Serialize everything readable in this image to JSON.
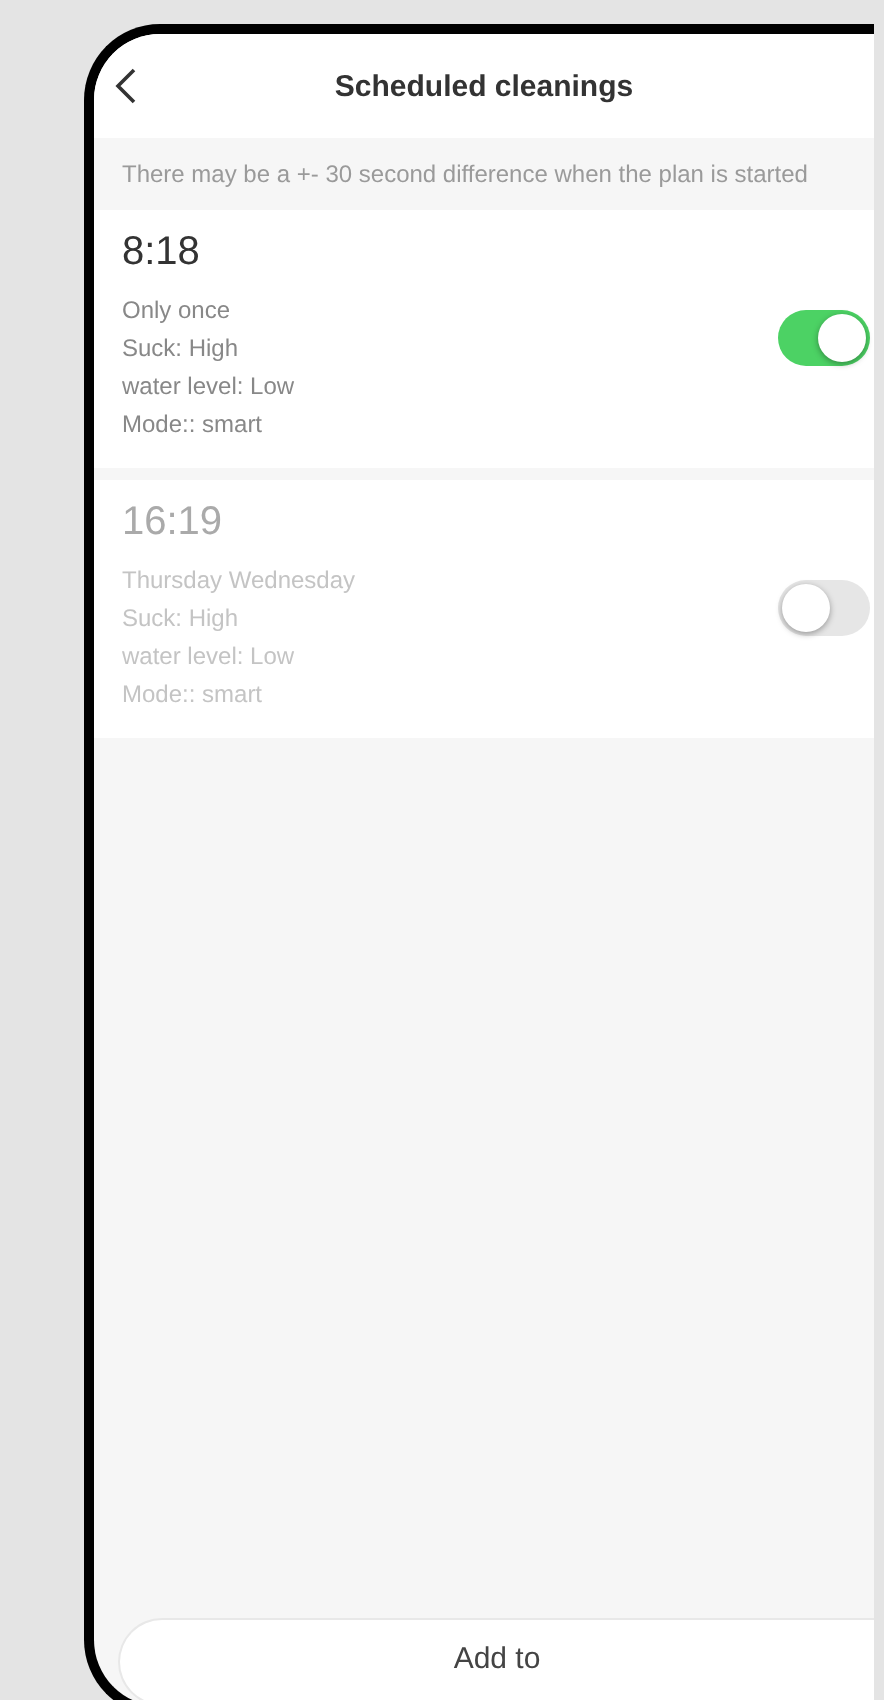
{
  "header": {
    "title": "Scheduled cleanings"
  },
  "notice": "There may be a +- 30 second difference when the plan is started",
  "schedules": [
    {
      "time": "8:18",
      "details": [
        "Only once",
        "Suck: High",
        "water level: Low",
        "Mode:: smart"
      ],
      "on": true
    },
    {
      "time": "16:19",
      "details": [
        "Thursday Wednesday",
        "Suck: High",
        "water level: Low",
        "Mode:: smart"
      ],
      "on": false
    }
  ],
  "add_button": "Add to"
}
